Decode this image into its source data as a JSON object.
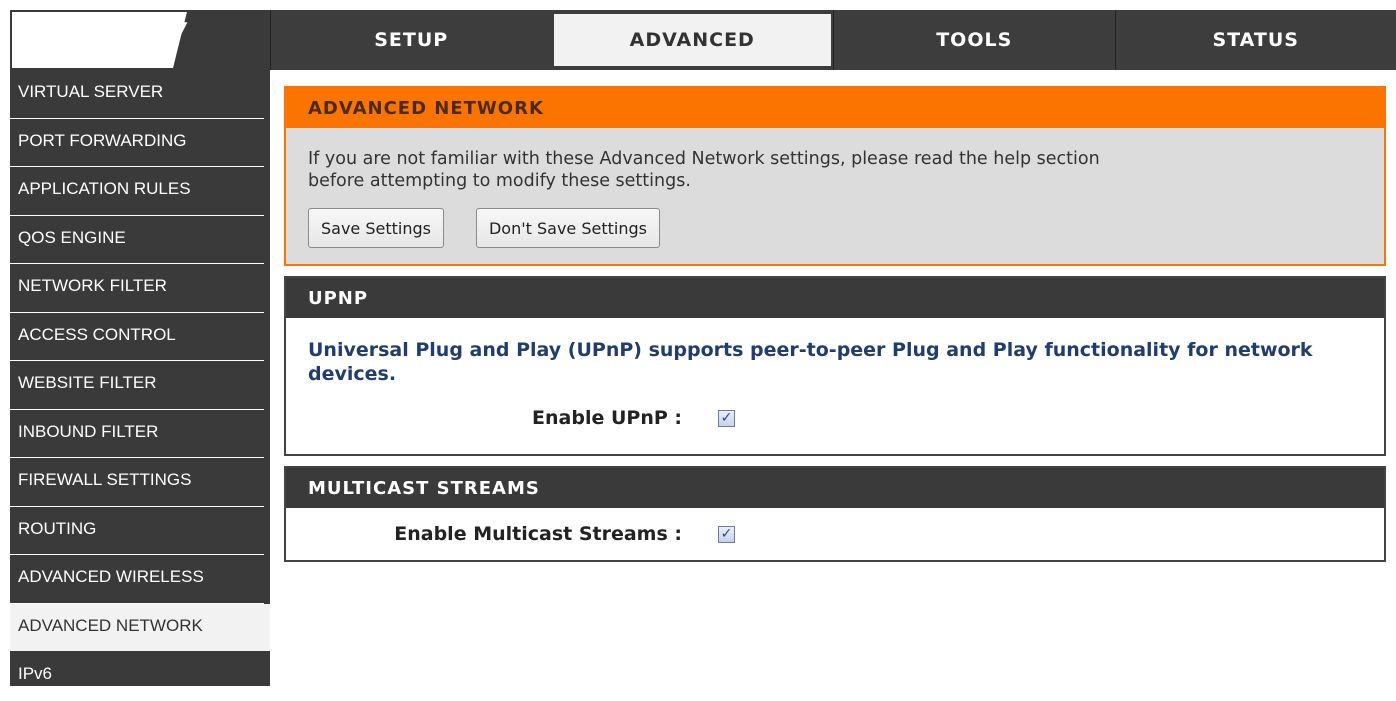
{
  "nav": {
    "tabs": [
      {
        "label": "SETUP",
        "active": false
      },
      {
        "label": "ADVANCED",
        "active": true
      },
      {
        "label": "TOOLS",
        "active": false
      },
      {
        "label": "STATUS",
        "active": false
      }
    ]
  },
  "sidebar": {
    "items": [
      {
        "label": "VIRTUAL SERVER"
      },
      {
        "label": "PORT FORWARDING"
      },
      {
        "label": "APPLICATION RULES"
      },
      {
        "label": "QOS ENGINE"
      },
      {
        "label": "NETWORK FILTER"
      },
      {
        "label": "ACCESS CONTROL"
      },
      {
        "label": "WEBSITE FILTER"
      },
      {
        "label": "INBOUND FILTER"
      },
      {
        "label": "FIREWALL SETTINGS"
      },
      {
        "label": "ROUTING"
      },
      {
        "label": "ADVANCED WIRELESS"
      },
      {
        "label": "ADVANCED NETWORK",
        "active": true
      },
      {
        "label": "IPv6"
      }
    ]
  },
  "advanced_network": {
    "title": "ADVANCED NETWORK",
    "intro": "If you are not familiar with these Advanced Network settings, please read the help section\nbefore attempting to modify these settings.",
    "save_label": "Save Settings",
    "dont_save_label": "Don't Save Settings"
  },
  "upnp": {
    "title": "UPNP",
    "description": "Universal Plug and Play (UPnP) supports peer-to-peer Plug and Play functionality for network devices.",
    "enable_label": "Enable UPnP :",
    "enabled": true
  },
  "multicast": {
    "title": "MULTICAST STREAMS",
    "enable_label": "Enable Multicast Streams :",
    "enabled": true
  },
  "colors": {
    "accent_orange": "#fb7400",
    "dark_bar": "#3a3a3a",
    "desc_blue": "#1f3d6e"
  },
  "icons": {
    "checkmark": "✓"
  }
}
